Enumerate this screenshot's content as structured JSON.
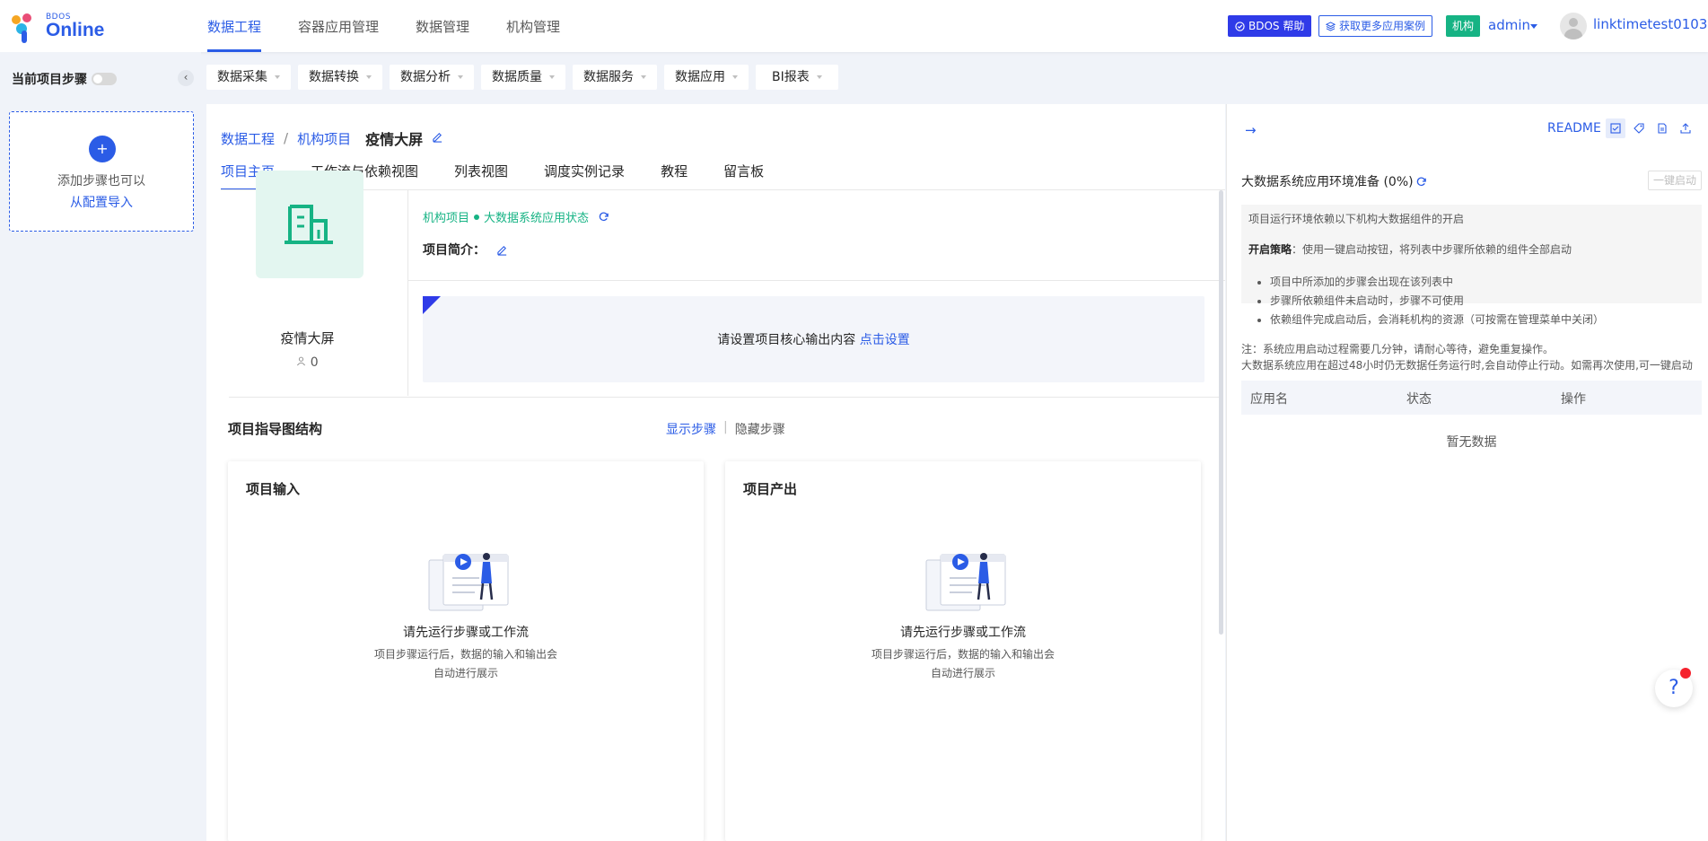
{
  "logo": {
    "small": "BDOS",
    "big": "Online"
  },
  "main_nav": [
    {
      "label": "数据工程",
      "active": true
    },
    {
      "label": "容器应用管理",
      "active": false
    },
    {
      "label": "数据管理",
      "active": false
    },
    {
      "label": "机构管理",
      "active": false
    }
  ],
  "header": {
    "help_label": "BDOS 帮助",
    "cases_label": "获取更多应用案例",
    "org_tag": "机构",
    "admin": "admin",
    "username": "linktimetest0103"
  },
  "sidebar": {
    "steps_label": "当前项目步骤",
    "add_step_text": "添加步骤也可以",
    "import_link": "从配置导入"
  },
  "subbar": [
    "数据采集",
    "数据转换",
    "数据分析",
    "数据质量",
    "数据服务",
    "数据应用",
    "BI报表"
  ],
  "breadcrumb": {
    "root": "数据工程",
    "middle": "机构项目",
    "current": "疫情大屏"
  },
  "tabs": [
    {
      "label": "项目主页",
      "active": true
    },
    {
      "label": "工作流与依赖视图",
      "active": false
    },
    {
      "label": "列表视图",
      "active": false
    },
    {
      "label": "调度实例记录",
      "active": false
    },
    {
      "label": "教程",
      "active": false
    },
    {
      "label": "留言板",
      "active": false
    }
  ],
  "project": {
    "name": "疫情大屏",
    "members": "0",
    "status_prefix": "机构项目",
    "status_text": "大数据系统应用状态",
    "intro_label": "项目简介：",
    "core_text": "请设置项目核心输出内容",
    "core_link": "点击设置"
  },
  "guide": {
    "title": "项目指导图结构",
    "show": "显示步骤",
    "hide": "隐藏步骤",
    "input_title": "项目输入",
    "output_title": "项目产出",
    "empty_main": "请先运行步骤或工作流",
    "empty_sub1": "项目步骤运行后，数据的输入和输出会",
    "empty_sub2": "自动进行展示"
  },
  "right_panel": {
    "readme": "README",
    "title": "大数据系统应用环境准备 (0%)",
    "oneclick": "一键启动",
    "notice_line": "项目运行环境依赖以下机构大数据组件的开启",
    "strategy_label": "开启策略",
    "strategy_text": "：使用一键启动按钮，将列表中步骤所依赖的组件全部启动",
    "bullets": [
      "项目中所添加的步骤会出现在该列表中",
      "步骤所依赖组件未启动时，步骤不可使用",
      "依赖组件完成启动后，会消耗机构的资源（可按需在管理菜单中关闭）"
    ],
    "note1": "注：系统应用启动过程需要几分钟，请耐心等待，避免重复操作。",
    "note2": "大数据系统应用在超过48小时仍无数据任务运行时,会自动停止行动。如需再次使用,可一键启动",
    "columns": [
      "应用名",
      "状态",
      "操作"
    ],
    "empty": "暂无数据"
  },
  "colors": {
    "primary": "#2b5ce6",
    "green": "#16b384",
    "help_bg": "#2f3be8"
  }
}
